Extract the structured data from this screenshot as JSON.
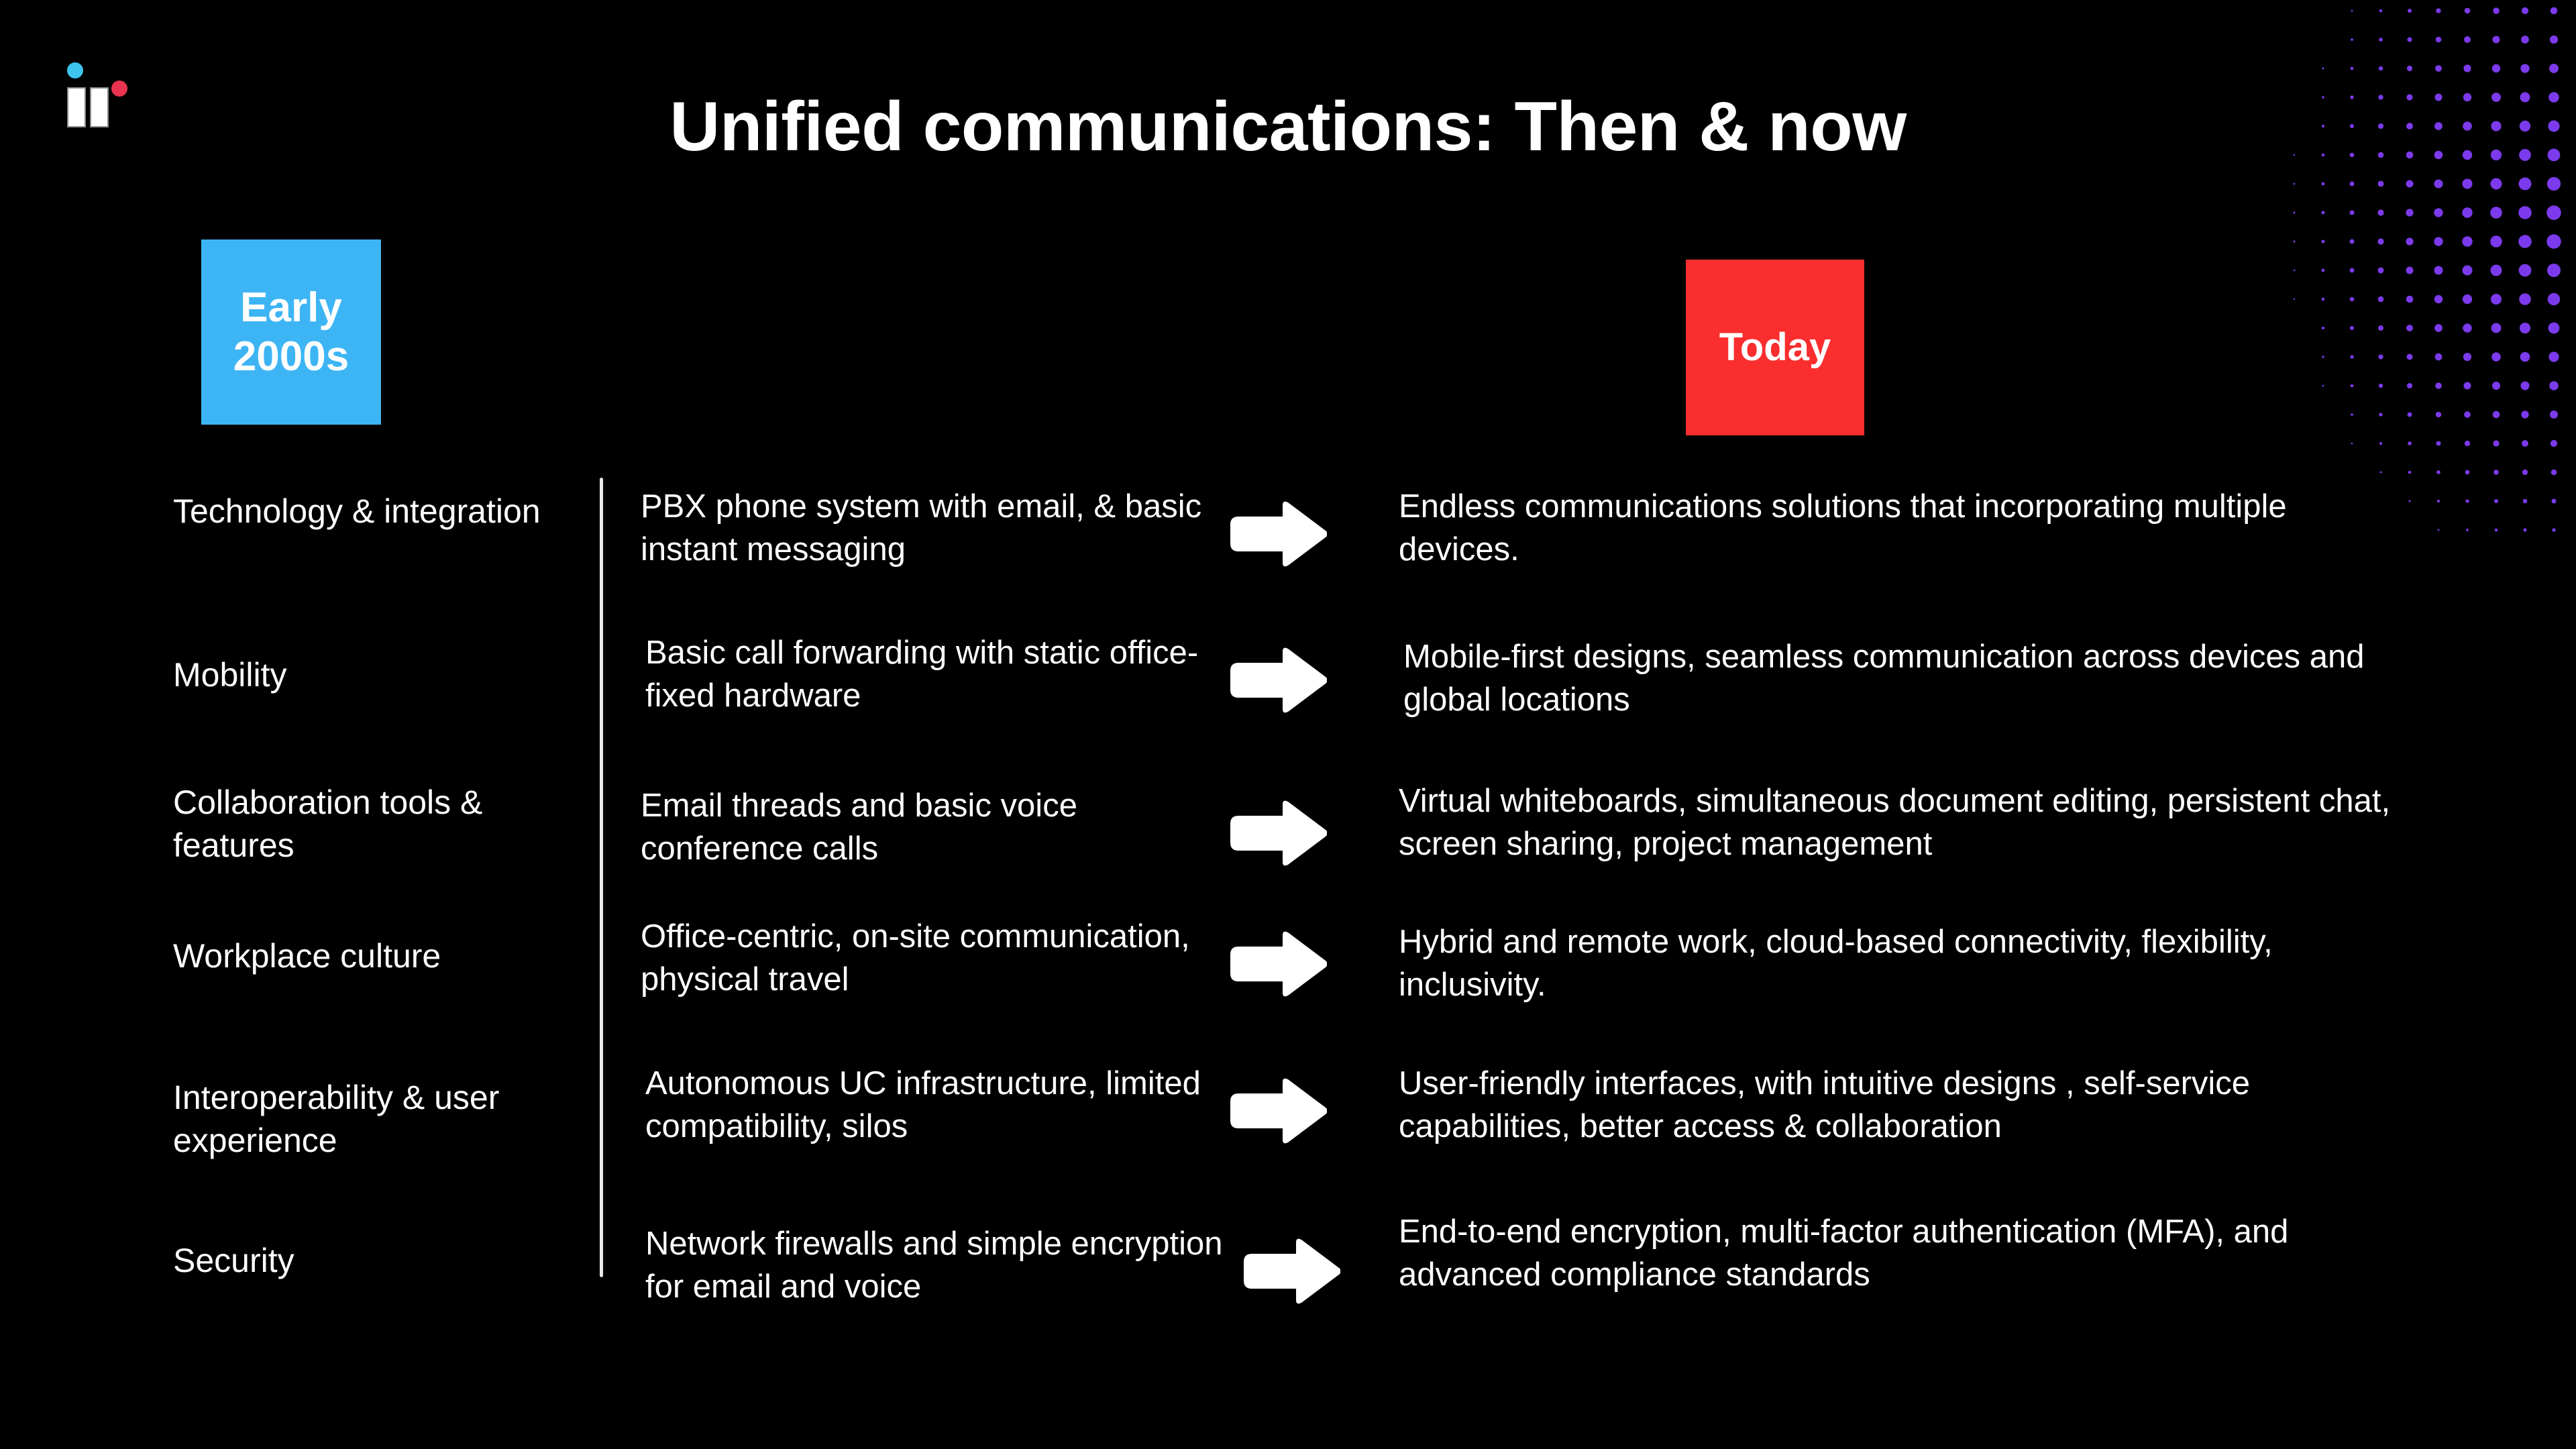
{
  "slide": {
    "title": "Unified communications: Then & now",
    "background_color": "#000000",
    "text_color": "#ffffff"
  },
  "logo": {
    "name": "brand-logo",
    "dot_cyan_color": "#3DC5ED",
    "dot_red_color": "#E8344E",
    "bar_color": "#ffffff"
  },
  "decor": {
    "halftone_dots_color": "#7C3AED"
  },
  "badges": {
    "early": {
      "line1": "Early",
      "line2": "2000s",
      "color": "#3DB5F5"
    },
    "today": {
      "line1": "Today",
      "color": "#FA2E2E"
    }
  },
  "arrow": {
    "icon": "right-arrow-icon",
    "color": "#ffffff"
  },
  "rows": [
    {
      "category": "Technology & integration",
      "then": "PBX phone system with email, & basic instant messaging",
      "now": "Endless communications solutions that incorporating multiple devices."
    },
    {
      "category": "Mobility",
      "then": "Basic call forwarding with static office-fixed hardware",
      "now": "Mobile-first designs, seamless communication across devices and global locations"
    },
    {
      "category": "Collaboration tools & features",
      "then": "Email threads and basic voice conference calls",
      "now": "Virtual whiteboards, simultaneous document editing, persistent chat, screen sharing, project management"
    },
    {
      "category": "Workplace culture",
      "then": "Office-centric,  on-site communication, physical travel",
      "now": "Hybrid and remote work, cloud-based  connectivity, flexibility, inclusivity."
    },
    {
      "category": "Interoperability & user experience",
      "then": "Autonomous UC infrastructure, limited compatibility, silos",
      "now": "User-friendly interfaces, with intuitive designs , self-service capabilities, better access & collaboration"
    },
    {
      "category": "Security",
      "then": "Network firewalls and simple encryption for email and voice",
      "now": "End-to-end encryption, multi-factor authentication (MFA), and advanced compliance standards"
    }
  ]
}
